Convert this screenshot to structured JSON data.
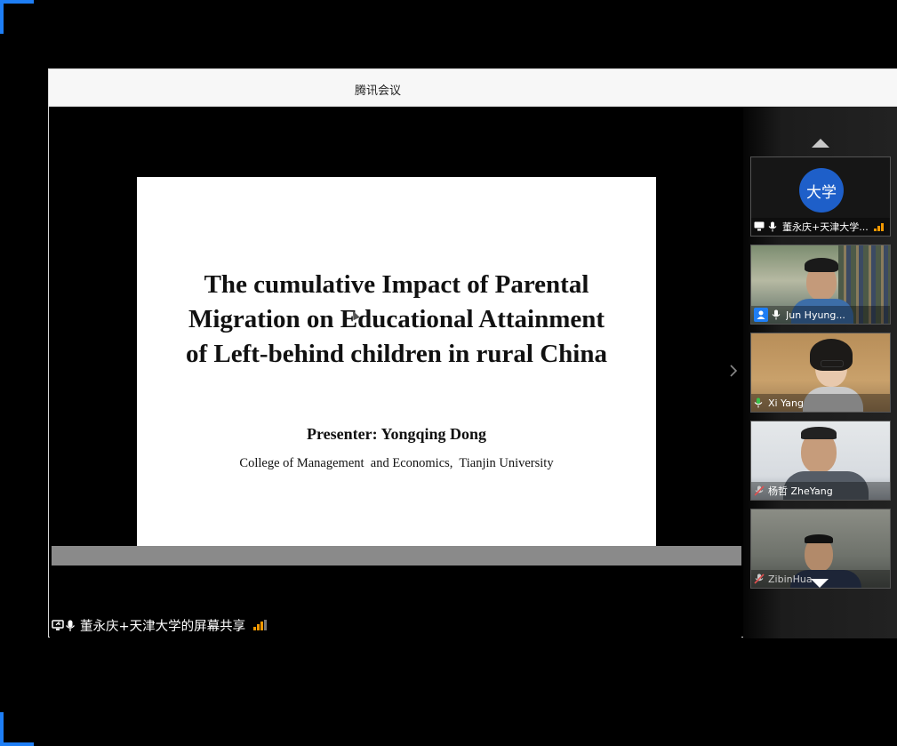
{
  "window": {
    "title": "腾讯会议"
  },
  "slide": {
    "title_lines": [
      "The cumulative Impact of Parental",
      "Migration on Educational Attainment",
      "of Left-behind children in rural China"
    ],
    "presenter": "Presenter: Yongqing Dong",
    "affiliation": "College of Management  and Economics,  Tianjin University"
  },
  "share_status": {
    "label": "董永庆+天津大学的屏幕共享"
  },
  "participants": [
    {
      "name": "董永庆+天津大学...",
      "avatar_text": "大学",
      "mic": "on",
      "sharing": true
    },
    {
      "name": "Jun Hyung...",
      "mic": "on",
      "video": true
    },
    {
      "name": "Xi Yang",
      "mic": "active",
      "video": true
    },
    {
      "name": "杨哲 ZheYang",
      "mic": "muted",
      "video": true
    },
    {
      "name": "ZibinHua",
      "mic": "muted",
      "video": true
    }
  ],
  "colors": {
    "accent": "#1e7ef5",
    "signal": "#f39800",
    "mic_active": "#39c24a",
    "mic_muted": "#e05050"
  }
}
